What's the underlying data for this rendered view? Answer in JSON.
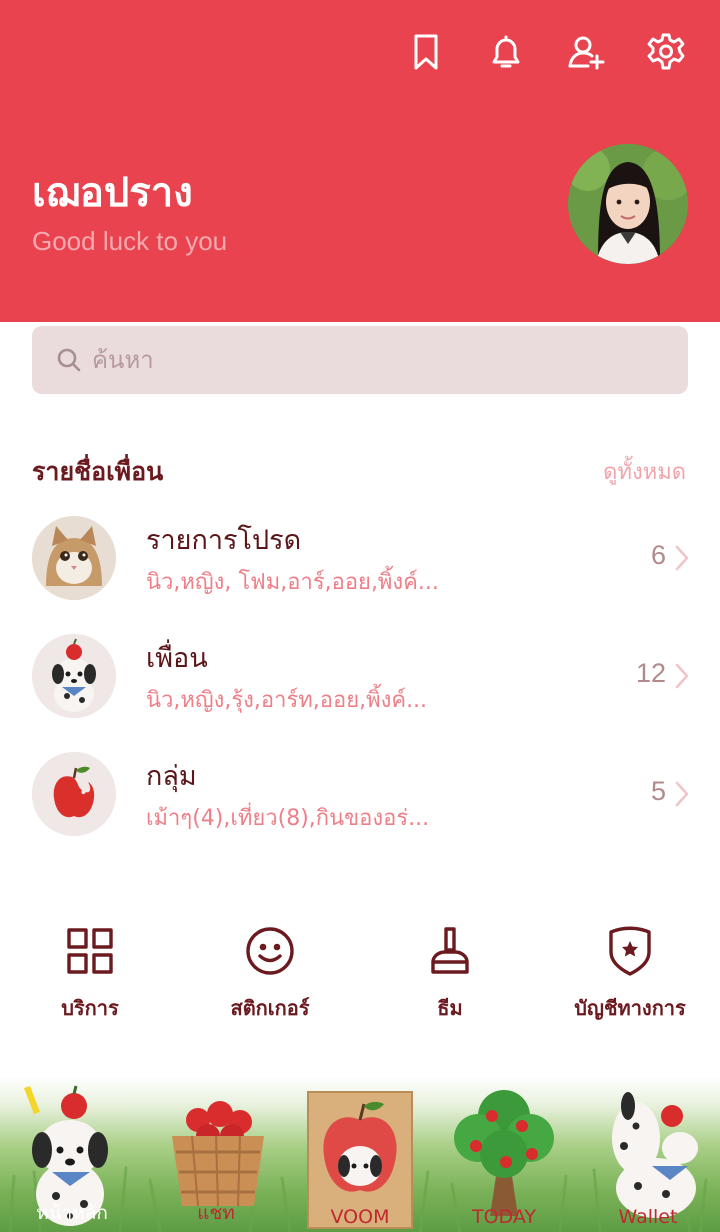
{
  "header": {
    "icons": [
      "bookmark-icon",
      "bell-icon",
      "add-friend-icon",
      "settings-icon"
    ],
    "profile_name": "เฌอปราง",
    "status_message": "Good luck to you"
  },
  "search": {
    "placeholder": "ค้นหา"
  },
  "friends": {
    "title": "รายชื่อเพื่อน",
    "see_all": "ดูทั้งหมด",
    "rows": [
      {
        "title": "รายการโปรด",
        "subtitle": "นิว,หญิง, โฟม,อาร์,ออย,พิ้งค์...",
        "count": "6",
        "avatar": "cat-avatar"
      },
      {
        "title": "เพื่อน",
        "subtitle": "นิว,หญิง,รุ้ง,อาร์ท,ออย,พิ้งค์...",
        "count": "12",
        "avatar": "dalmatian-avatar"
      },
      {
        "title": "กลุ่ม",
        "subtitle": "เม้าๆ(4),เที่ยว(8),กินของอร่...",
        "count": "5",
        "avatar": "apple-avatar"
      }
    ]
  },
  "quick_menu": [
    {
      "label": "บริการ",
      "icon": "grid-icon"
    },
    {
      "label": "สติกเกอร์",
      "icon": "smiley-icon"
    },
    {
      "label": "ธีม",
      "icon": "brush-icon"
    },
    {
      "label": "บัญชีทางการ",
      "icon": "official-shield-icon"
    }
  ],
  "bottom_nav": [
    {
      "label": "หน้าหลัก",
      "icon": "dalmatian-home-icon",
      "active": true
    },
    {
      "label": "แชท",
      "icon": "apple-basket-icon",
      "active": false
    },
    {
      "label": "VOOM",
      "icon": "apple-card-icon",
      "active": false
    },
    {
      "label": "TODAY",
      "icon": "apple-tree-icon",
      "active": false
    },
    {
      "label": "Wallet",
      "icon": "dalmatian-wallet-icon",
      "active": false
    }
  ],
  "colors": {
    "header_bg": "#e8434f",
    "accent_dark": "#6b1a1f",
    "subtitle_pink": "#ee7f88"
  }
}
